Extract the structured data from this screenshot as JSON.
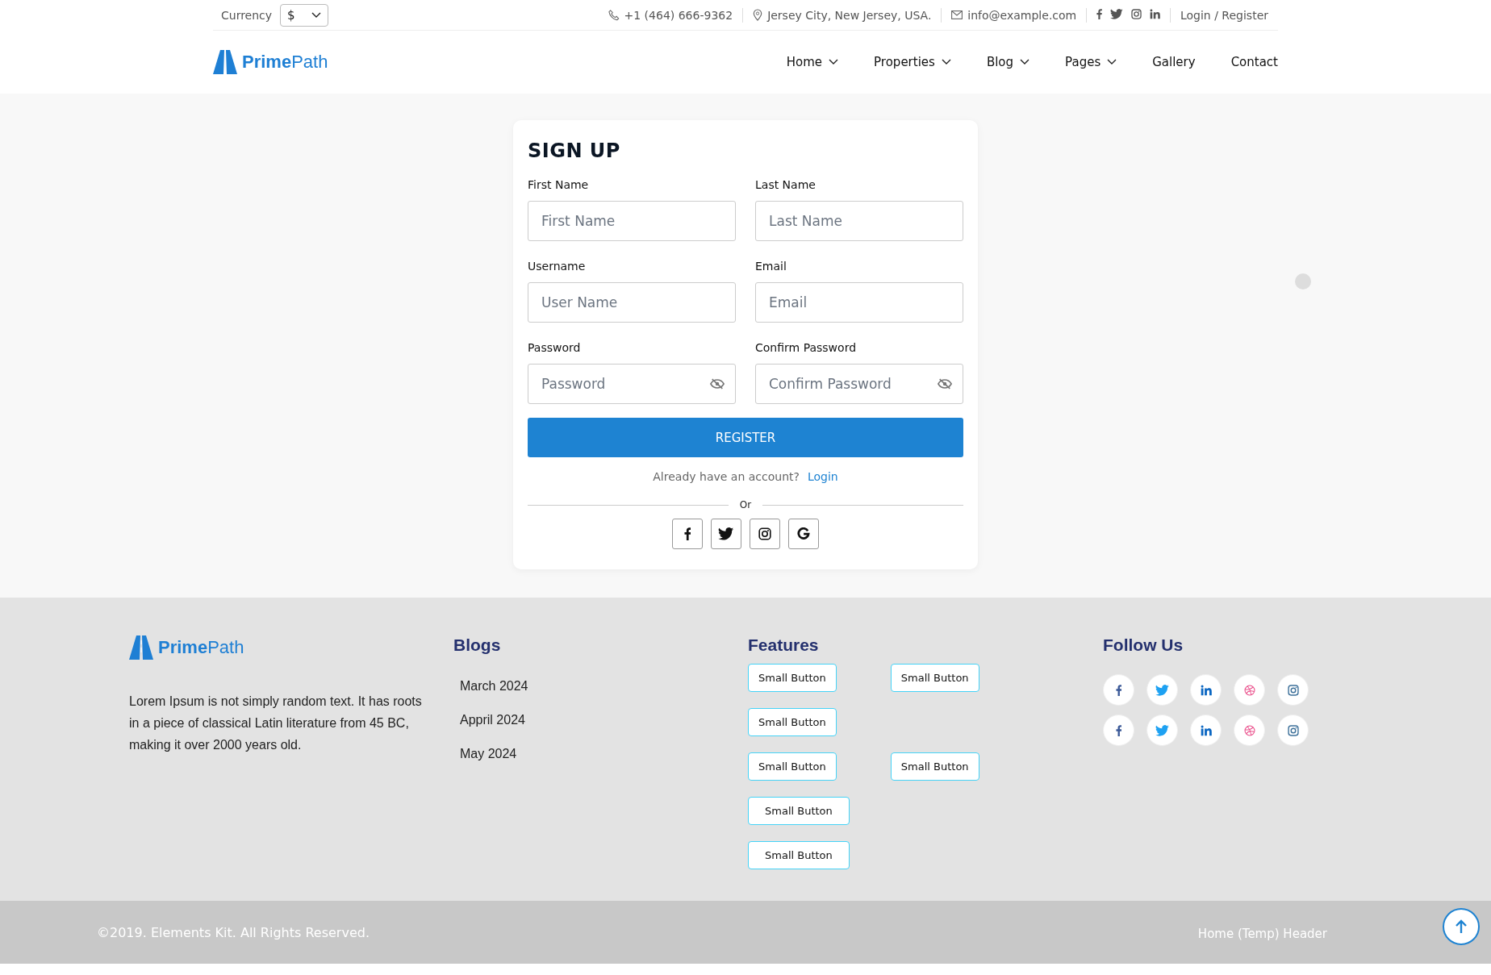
{
  "topbar": {
    "currency_label": "Currency",
    "currency_value": "$",
    "phone": "+1 (464) 666-9362",
    "address": "Jersey City, New Jersey, USA.",
    "email": "info@example.com",
    "socials": [
      {
        "kind": "facebook"
      },
      {
        "kind": "twitter"
      },
      {
        "kind": "instagram"
      },
      {
        "kind": "linkedin"
      }
    ],
    "login": "Login / Register"
  },
  "nav": {
    "logo": {
      "bold": "Prime",
      "light": "Path"
    },
    "items": [
      {
        "label": "Home",
        "dropdown": true
      },
      {
        "label": "Properties",
        "dropdown": true
      },
      {
        "label": "Blog",
        "dropdown": true
      },
      {
        "label": "Pages",
        "dropdown": true
      },
      {
        "label": "Gallery",
        "dropdown": false
      },
      {
        "label": "Contact",
        "dropdown": false
      }
    ]
  },
  "signup": {
    "title": "SIGN UP",
    "fields": [
      {
        "label": "First Name",
        "placeholder": "First Name",
        "kind": "text"
      },
      {
        "label": "Last Name",
        "placeholder": "Last Name",
        "kind": "text"
      },
      {
        "label": "Username",
        "placeholder": "User Name",
        "kind": "text"
      },
      {
        "label": "Email",
        "placeholder": "Email",
        "kind": "text"
      },
      {
        "label": "Password",
        "placeholder": "Password",
        "kind": "password"
      },
      {
        "label": "Confirm Password",
        "placeholder": "Confirm Password",
        "kind": "password"
      }
    ],
    "submit": "REGISTER",
    "account_prompt": "Already have an account?",
    "login_link": "Login",
    "divider": "Or",
    "socials": [
      {
        "kind": "facebook"
      },
      {
        "kind": "twitter"
      },
      {
        "kind": "instagram"
      },
      {
        "kind": "google"
      }
    ]
  },
  "footer": {
    "logo": {
      "bold": "Prime",
      "light": "Path"
    },
    "about": "Lorem Ipsum is not simply random text. It has roots in a piece of classical Latin literature from 45 BC, making it over 2000 years old.",
    "blogs": {
      "title": "Blogs",
      "items": [
        "March 2024",
        "Appril 2024",
        "May 2024"
      ]
    },
    "features": {
      "title": "Features",
      "rows": [
        [
          "Small Button",
          "Small Button"
        ],
        [
          "Small Button"
        ],
        [
          "Small Button",
          "Small Button"
        ],
        [
          "Small Button"
        ],
        [
          "Small Button"
        ]
      ]
    },
    "follow": {
      "title": "Follow Us",
      "rows": [
        [
          {
            "kind": "facebook"
          },
          {
            "kind": "twitter"
          },
          {
            "kind": "linkedin"
          },
          {
            "kind": "dribbble"
          },
          {
            "kind": "instagram"
          }
        ],
        [
          {
            "kind": "facebook"
          },
          {
            "kind": "twitter"
          },
          {
            "kind": "linkedin"
          },
          {
            "kind": "dribbble"
          },
          {
            "kind": "instagram"
          }
        ]
      ]
    }
  },
  "bottom": {
    "copyright": "©2019. Elements Kit. All Rights Reserved.",
    "link": "Home (Temp) Header"
  }
}
